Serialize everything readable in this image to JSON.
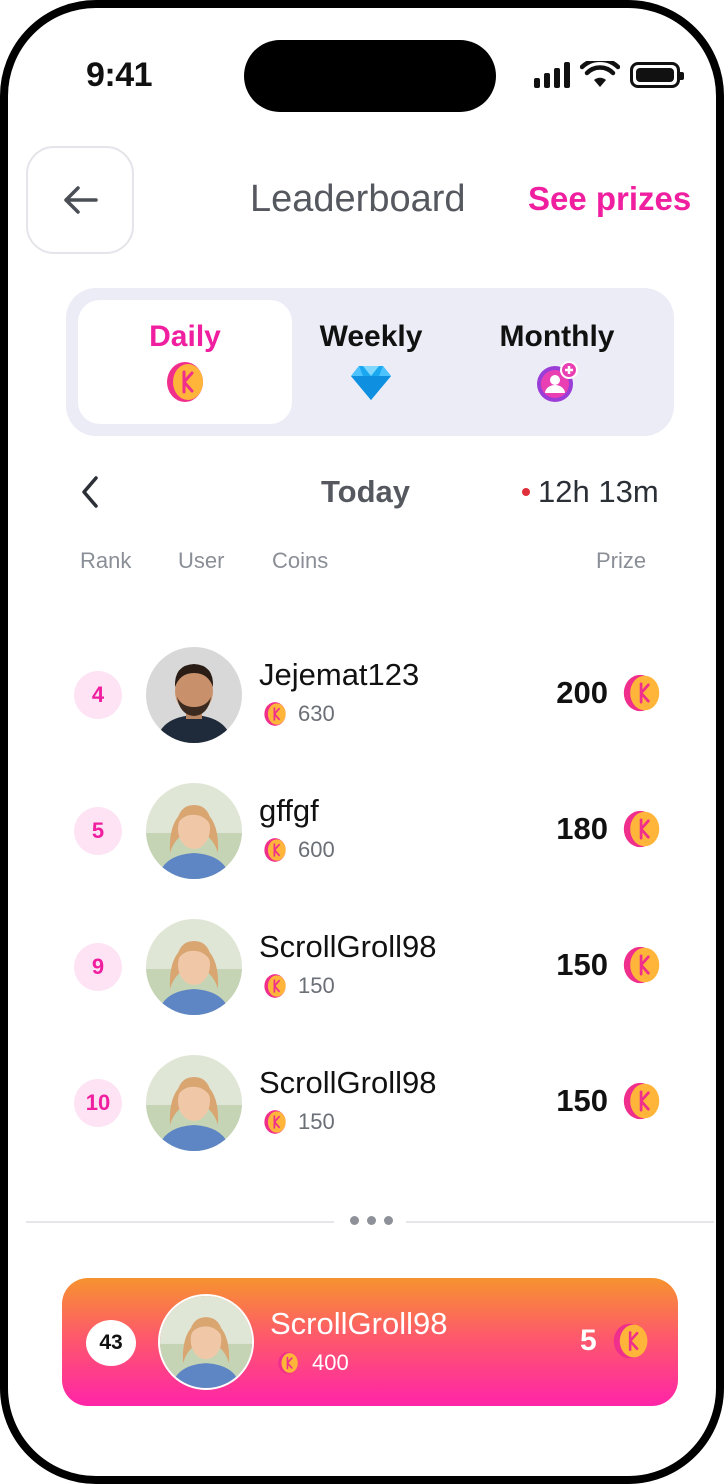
{
  "status_bar": {
    "time": "9:41"
  },
  "header": {
    "title": "Leaderboard",
    "see_prizes": "See prizes"
  },
  "tabs": [
    {
      "label": "Daily",
      "icon": "coin-icon",
      "active": true
    },
    {
      "label": "Weekly",
      "icon": "diamond-icon",
      "active": false
    },
    {
      "label": "Monthly",
      "icon": "user-plus-badge-icon",
      "active": false
    }
  ],
  "period": {
    "label": "Today",
    "timer": "12h 13m"
  },
  "columns": {
    "rank": "Rank",
    "user": "User",
    "coins": "Coins",
    "prize": "Prize"
  },
  "rows": [
    {
      "rank": "4",
      "name": "Jejemat123",
      "coins": "630",
      "prize": "200",
      "avatar": "man-avatar"
    },
    {
      "rank": "5",
      "name": "gffgf",
      "coins": "600",
      "prize": "180",
      "avatar": "woman-avatar"
    },
    {
      "rank": "9",
      "name": "ScrollGroll98",
      "coins": "150",
      "prize": "150",
      "avatar": "woman-avatar"
    },
    {
      "rank": "10",
      "name": "ScrollGroll98",
      "coins": "150",
      "prize": "150",
      "avatar": "woman-avatar"
    }
  ],
  "current_user": {
    "rank": "43",
    "name": "ScrollGroll98",
    "coins": "400",
    "prize": "5"
  },
  "colors": {
    "accent": "#f01fa0",
    "tab_bg": "#ececf7",
    "card_top": "#f6932e",
    "card_bottom": "#ff24a8"
  }
}
